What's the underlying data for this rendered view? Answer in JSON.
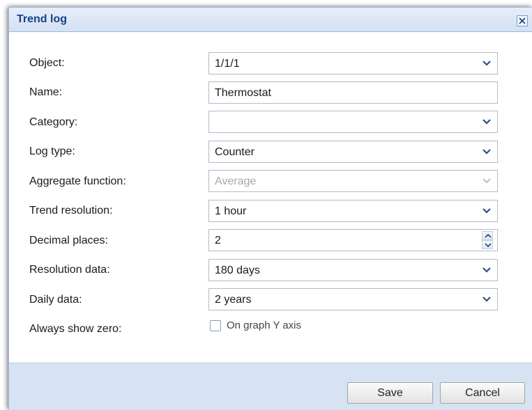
{
  "dialog": {
    "title": "Trend log",
    "close_icon": "close-icon"
  },
  "form": {
    "object": {
      "label": "Object:",
      "value": "1/1/1"
    },
    "name": {
      "label": "Name:",
      "value": "Thermostat"
    },
    "category": {
      "label": "Category:",
      "value": ""
    },
    "log_type": {
      "label": "Log type:",
      "value": "Counter"
    },
    "aggregate_function": {
      "label": "Aggregate function:",
      "value": "Average",
      "disabled": true
    },
    "trend_resolution": {
      "label": "Trend resolution:",
      "value": "1 hour"
    },
    "decimal_places": {
      "label": "Decimal places:",
      "value": "2"
    },
    "resolution_data": {
      "label": "Resolution data:",
      "value": "180 days"
    },
    "daily_data": {
      "label": "Daily data:",
      "value": "2 years"
    },
    "always_show_zero": {
      "label": "Always show zero:",
      "checkbox_label": "On graph Y axis",
      "checked": false
    }
  },
  "buttons": {
    "save": "Save",
    "cancel": "Cancel"
  },
  "colors": {
    "title_text": "#15428b",
    "title_bar": "#d4e1f2",
    "footer": "#d7e3f2",
    "field_border": "#b5b8c8",
    "trigger_arrow": "#2d4f80"
  }
}
